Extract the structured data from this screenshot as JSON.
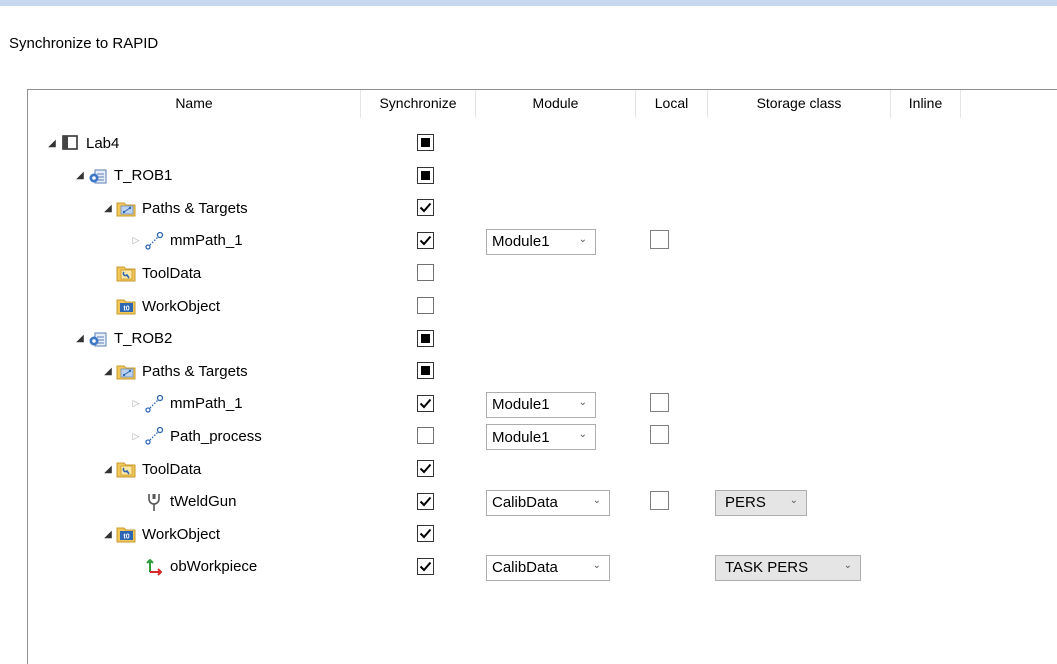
{
  "dialog": {
    "title": "Synchronize to RAPID"
  },
  "columns": {
    "name": "Name",
    "synchronize": "Synchronize",
    "module": "Module",
    "local": "Local",
    "storage_class": "Storage class",
    "inline": "Inline"
  },
  "rows": [
    {
      "label": "Lab4",
      "expand": "expanded",
      "icon": "station-icon",
      "sync": "indeterminate"
    },
    {
      "label": "T_ROB1",
      "expand": "expanded",
      "icon": "task-icon",
      "sync": "indeterminate"
    },
    {
      "label": "Paths & Targets",
      "expand": "expanded",
      "icon": "paths-folder-icon",
      "sync": "checked"
    },
    {
      "label": "mmPath_1",
      "expand": "collapsed",
      "icon": "path-icon",
      "sync": "checked",
      "module": "Module1",
      "local": "unchecked"
    },
    {
      "label": "ToolData",
      "expand": "none",
      "icon": "tooldata-folder-icon",
      "sync": "unchecked"
    },
    {
      "label": "WorkObject",
      "expand": "none",
      "icon": "workobject-folder-icon",
      "sync": "unchecked"
    },
    {
      "label": "T_ROB2",
      "expand": "expanded",
      "icon": "task-icon",
      "sync": "indeterminate"
    },
    {
      "label": "Paths & Targets",
      "expand": "expanded",
      "icon": "paths-folder-icon",
      "sync": "indeterminate"
    },
    {
      "label": "mmPath_1",
      "expand": "collapsed",
      "icon": "path-icon",
      "sync": "checked",
      "module": "Module1",
      "local": "unchecked"
    },
    {
      "label": "Path_process",
      "expand": "collapsed",
      "icon": "path-icon",
      "sync": "unchecked",
      "module": "Module1",
      "local": "unchecked"
    },
    {
      "label": "ToolData",
      "expand": "expanded",
      "icon": "tooldata-folder-icon",
      "sync": "checked"
    },
    {
      "label": "tWeldGun",
      "expand": "none",
      "icon": "tool-icon",
      "sync": "checked",
      "module": "CalibData",
      "local": "unchecked",
      "storage": "PERS"
    },
    {
      "label": "WorkObject",
      "expand": "expanded",
      "icon": "workobject-folder-icon",
      "sync": "checked"
    },
    {
      "label": "obWorkpiece",
      "expand": "none",
      "icon": "workobject-frame-icon",
      "sync": "checked",
      "module": "CalibData",
      "storage": "TASK PERS"
    }
  ]
}
